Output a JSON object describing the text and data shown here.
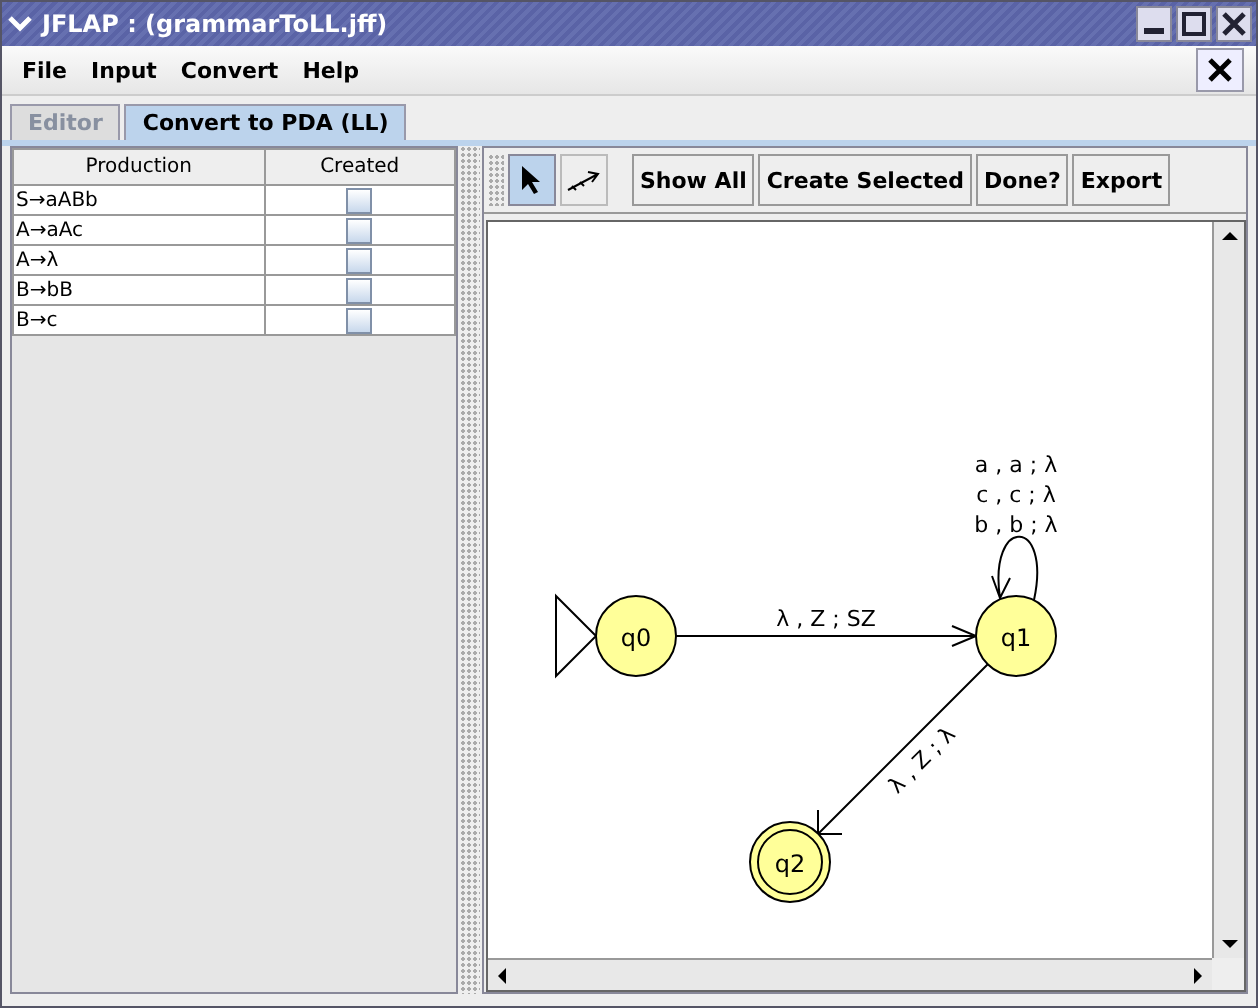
{
  "window": {
    "title": "JFLAP : (grammarToLL.jff)"
  },
  "menu": [
    "File",
    "Input",
    "Convert",
    "Help"
  ],
  "tabs": [
    {
      "label": "Editor",
      "selected": false,
      "disabled": true
    },
    {
      "label": "Convert to PDA (LL)",
      "selected": true,
      "disabled": false
    }
  ],
  "table": {
    "columns": [
      "Production",
      "Created"
    ],
    "rows": [
      {
        "production": "S→aABb",
        "created": false
      },
      {
        "production": "A→aAc",
        "created": false
      },
      {
        "production": "A→λ",
        "created": false
      },
      {
        "production": "B→bB",
        "created": false
      },
      {
        "production": "B→c",
        "created": false
      }
    ]
  },
  "tools": [
    {
      "kind": "pointer",
      "selected": true
    },
    {
      "kind": "transition",
      "selected": false
    }
  ],
  "buttons": [
    "Show All",
    "Create Selected",
    "Done?",
    "Export"
  ],
  "states": [
    {
      "label": "q0",
      "initial": true,
      "final": false
    },
    {
      "label": "q1",
      "initial": false,
      "final": false
    },
    {
      "label": "q2",
      "initial": false,
      "final": true
    }
  ],
  "transitions": [
    {
      "kind": "straight",
      "labels": [
        "λ , Z ; SZ"
      ]
    },
    {
      "kind": "loop",
      "labels": [
        "a , a ; λ",
        "c , c ; λ",
        "b , b ; λ"
      ]
    },
    {
      "kind": "diagonal",
      "labels": [
        "λ , Z ; λ"
      ]
    }
  ]
}
